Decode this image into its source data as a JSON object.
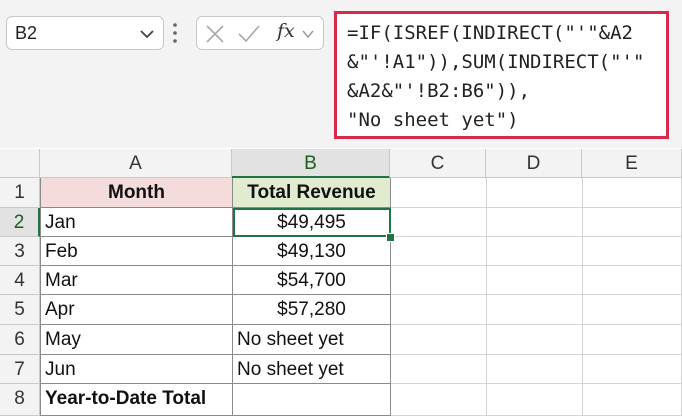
{
  "name_box": {
    "value": "B2"
  },
  "formula_bar": {
    "formula_lines": [
      "=IF(ISREF(INDIRECT(\"'\"&A2",
      "&\"'!A1\")),SUM(INDIRECT(\"'\"",
      "&A2&\"'!B2:B6\")),",
      "\"No sheet yet\")"
    ],
    "fx_label": "fx",
    "highlight_color": "#d72a4b"
  },
  "grid": {
    "columns": [
      "A",
      "B",
      "C",
      "D",
      "E"
    ],
    "rows": [
      "1",
      "2",
      "3",
      "4",
      "5",
      "6",
      "7",
      "8"
    ],
    "active_cell": "B2",
    "selection_color": "#217346",
    "header_row": {
      "a": "Month",
      "b": "Total Revenue",
      "a_fill": "#f5dcdc",
      "b_fill": "#e0ebd0"
    },
    "data_rows": [
      {
        "a": "Jan",
        "b": "$49,495"
      },
      {
        "a": "Feb",
        "b": "$49,130"
      },
      {
        "a": "Mar",
        "b": "$54,700"
      },
      {
        "a": "Apr",
        "b": "$57,280"
      },
      {
        "a": "May",
        "b": "No sheet yet"
      },
      {
        "a": "Jun",
        "b": "No sheet yet"
      },
      {
        "a": "Year-to-Date Total",
        "b": ""
      }
    ]
  }
}
